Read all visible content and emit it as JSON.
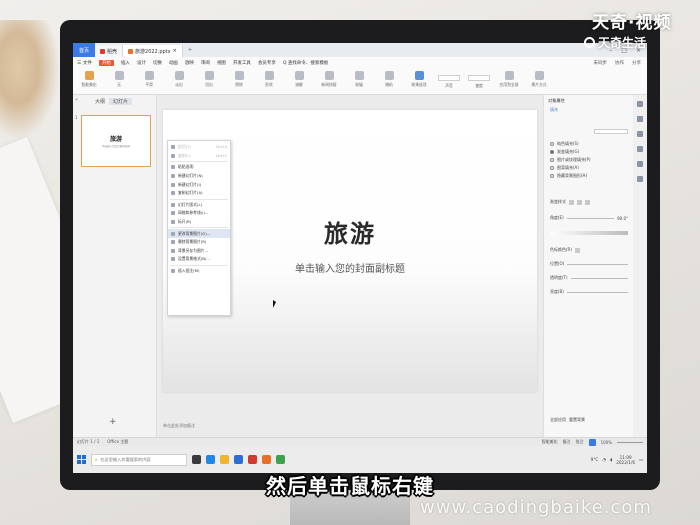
{
  "app": {
    "tabs": [
      {
        "label": "首页"
      },
      {
        "label": "稻壳"
      },
      {
        "label": "旅游2022.pptx"
      }
    ],
    "new_tab": "+"
  },
  "menu": {
    "items": [
      "三 文件",
      "开始",
      "插入",
      "设计",
      "切换",
      "动画",
      "放映",
      "审阅",
      "视图",
      "开发工具",
      "会员专享",
      "Q 查找命令、搜索模板"
    ],
    "active_index": 1,
    "right": [
      "未同步",
      "协作",
      "分享"
    ]
  },
  "ribbon": {
    "buttons": [
      "智能美化",
      "无",
      "平滑",
      "淡出",
      "切出",
      "擦除",
      "形状",
      "溶解",
      "新闻快报",
      "轮辐",
      "随机",
      "效果选项",
      "声音",
      "速度",
      "应用到全部",
      "换片方式"
    ]
  },
  "left_pane": {
    "tabs": [
      "大纲",
      "幻灯片"
    ],
    "slide_number": "1",
    "thumb_title": "旅游",
    "thumb_subtitle": "单击输入您的封面副标题",
    "add": "+"
  },
  "slide": {
    "title": "旅游",
    "subtitle": "单击输入您的封面副标题"
  },
  "notes_placeholder": "单击此处添加备注",
  "context_menu": {
    "items": [
      {
        "label": "剪切(T)",
        "shortcut": "Ctrl+X",
        "disabled": true
      },
      {
        "label": "复制(C)",
        "shortcut": "Ctrl+C",
        "disabled": true
      },
      {
        "label": "粘贴选项:",
        "shortcut": "",
        "disabled": false
      },
      {
        "label": "新建幻灯片(N)",
        "shortcut": "",
        "disabled": false
      },
      {
        "label": "新建幻灯片(I)",
        "shortcut": "",
        "disabled": false
      },
      {
        "label": "复制幻灯片(A)",
        "shortcut": "",
        "disabled": false
      },
      {
        "label": "幻灯片版式(L)",
        "shortcut": "",
        "disabled": false
      },
      {
        "label": "网格和参考线(I)...",
        "shortcut": "",
        "disabled": false
      },
      {
        "label": "标尺(R)",
        "shortcut": "",
        "disabled": false
      },
      {
        "label": "更改背景图片(G)...",
        "shortcut": "",
        "disabled": false,
        "highlight": true
      },
      {
        "label": "删除背景图片(R)",
        "shortcut": "",
        "disabled": false
      },
      {
        "label": "背景另存为图片...",
        "shortcut": "",
        "disabled": false
      },
      {
        "label": "设置背景格式(B)...",
        "shortcut": "",
        "disabled": false
      },
      {
        "label": "插入批注(M)",
        "shortcut": "",
        "disabled": false
      }
    ]
  },
  "right_pane": {
    "title": "对象属性",
    "tab": "填充",
    "fill_options": [
      "纯色填充(S)",
      "渐变填充(G)",
      "图片或纹理填充(P)",
      "图案填充(A)",
      "隐藏背景图形(H)"
    ],
    "checked_index": 1,
    "gradient_label": "渐变样式",
    "angle_label": "角度(E)",
    "angle_value": "90.0°",
    "stops_label": "色标颜色(R)",
    "position_label": "位置(O)",
    "transparency_label": "透明度(T)",
    "brightness_label": "亮度(B)",
    "apply_all": "全部应用",
    "reset": "重置背景"
  },
  "status": {
    "slide_info": "幻灯片 1 / 1",
    "theme": "Office 主题",
    "smart_beautify": "智能美化",
    "notes": "备注",
    "comment": "批注",
    "zoom": "100%"
  },
  "taskbar": {
    "search_placeholder": "在这里输入你要搜索的内容",
    "temperature": "9°C",
    "time": "11:09",
    "date": "2022/1/6"
  },
  "overlay": {
    "brand": "天奇·视频",
    "brand_sub": "天奇生活",
    "subtitle": "然后单击鼠标右键",
    "watermark": "www.caodingbaike.com"
  },
  "colors": {
    "accent_blue": "#3b7be8",
    "accent_orange": "#e85a2c",
    "selection_border": "#e2a250"
  }
}
